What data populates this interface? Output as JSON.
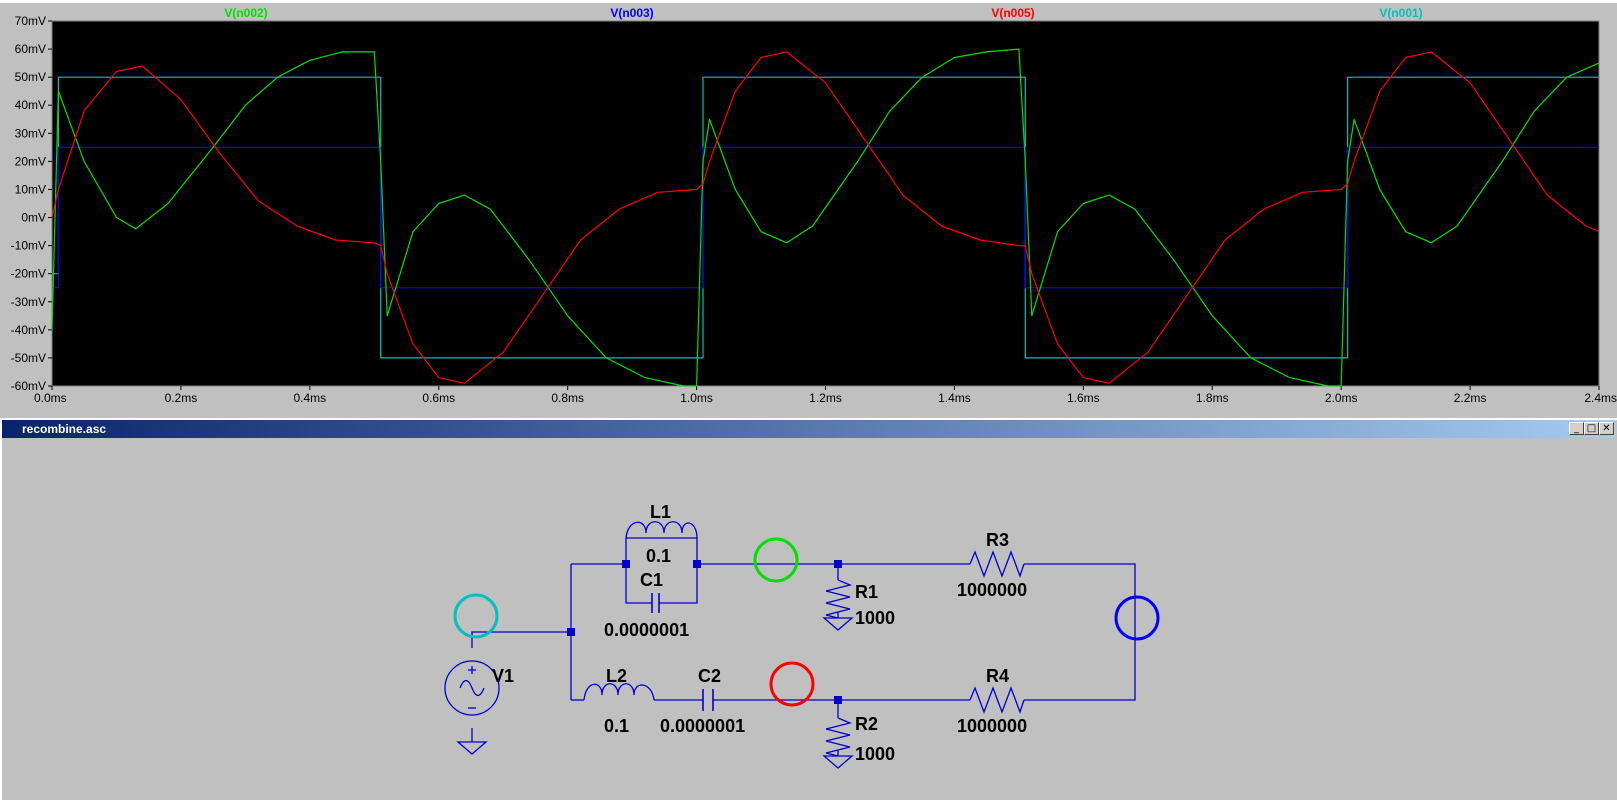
{
  "plot": {
    "traces": [
      {
        "id": "n002",
        "name": "V(n002)",
        "color": "#00e000"
      },
      {
        "id": "n003",
        "name": "V(n003)",
        "color": "#0000ff"
      },
      {
        "id": "n005",
        "name": "V(n005)",
        "color": "#ff0000"
      },
      {
        "id": "n001",
        "name": "V(n001)",
        "color": "#00c0c0"
      }
    ],
    "y_ticks": [
      "70mV",
      "60mV",
      "50mV",
      "40mV",
      "30mV",
      "20mV",
      "10mV",
      "0mV",
      "-10mV",
      "-20mV",
      "-30mV",
      "-40mV",
      "-50mV",
      "-60mV"
    ],
    "x_ticks": [
      "0.0ms",
      "0.2ms",
      "0.4ms",
      "0.6ms",
      "0.8ms",
      "1.0ms",
      "1.2ms",
      "1.4ms",
      "1.6ms",
      "1.8ms",
      "2.0ms",
      "2.2ms",
      "2.4ms"
    ],
    "background": "#000000"
  },
  "chart_data": {
    "type": "line",
    "x_unit": "ms",
    "y_unit": "mV",
    "xlim": [
      0,
      2.4
    ],
    "ylim": [
      -60,
      70
    ],
    "series": [
      {
        "name": "V(n001)",
        "x": [
          0,
          0.01,
          0.01,
          0.5,
          0.51,
          0.51,
          1.0,
          1.01,
          1.01,
          1.5,
          1.51,
          1.51,
          2.0,
          2.01,
          2.01,
          2.4
        ],
        "values": [
          -20,
          -20,
          50,
          50,
          50,
          -50,
          -50,
          -50,
          50,
          50,
          50,
          -50,
          -50,
          -50,
          50,
          50
        ]
      },
      {
        "name": "V(n003)",
        "x": [
          0,
          0.01,
          0.01,
          0.5,
          0.51,
          0.51,
          1.0,
          1.01,
          1.01,
          1.5,
          1.51,
          1.51,
          2.0,
          2.01,
          2.01,
          2.4
        ],
        "values": [
          -25,
          -25,
          25,
          25,
          25,
          -25,
          -25,
          -25,
          25,
          25,
          25,
          -25,
          -25,
          -25,
          25,
          25
        ]
      },
      {
        "name": "V(n002)",
        "x": [
          0,
          0.01,
          0.05,
          0.1,
          0.13,
          0.18,
          0.25,
          0.3,
          0.35,
          0.4,
          0.45,
          0.5,
          0.51,
          0.52,
          0.56,
          0.6,
          0.64,
          0.68,
          0.74,
          0.8,
          0.86,
          0.92,
          0.98,
          1.0,
          1.01,
          1.02,
          1.06,
          1.1,
          1.14,
          1.18,
          1.25,
          1.3,
          1.35,
          1.4,
          1.45,
          1.5,
          1.51,
          1.52,
          1.56,
          1.6,
          1.64,
          1.68,
          1.74,
          1.8,
          1.86,
          1.92,
          1.98,
          2.0,
          2.01,
          2.02,
          2.06,
          2.1,
          2.14,
          2.18,
          2.25,
          2.3,
          2.35,
          2.4
        ],
        "values": [
          -40,
          45,
          20,
          0,
          -4,
          5,
          25,
          40,
          50,
          56,
          59,
          59,
          20,
          -35,
          -5,
          5,
          8,
          3,
          -15,
          -35,
          -50,
          -57,
          -60,
          -60,
          20,
          35,
          10,
          -5,
          -9,
          -3,
          20,
          38,
          50,
          57,
          59,
          60,
          20,
          -35,
          -5,
          5,
          8,
          3,
          -15,
          -35,
          -50,
          -57,
          -60,
          -60,
          20,
          35,
          10,
          -5,
          -9,
          -3,
          20,
          38,
          50,
          55
        ]
      },
      {
        "name": "V(n005)",
        "x": [
          0,
          0.01,
          0.05,
          0.1,
          0.14,
          0.2,
          0.26,
          0.32,
          0.38,
          0.44,
          0.5,
          0.51,
          0.52,
          0.56,
          0.6,
          0.64,
          0.7,
          0.76,
          0.82,
          0.88,
          0.94,
          1.0,
          1.01,
          1.02,
          1.06,
          1.1,
          1.14,
          1.2,
          1.26,
          1.32,
          1.38,
          1.44,
          1.5,
          1.51,
          1.52,
          1.56,
          1.6,
          1.64,
          1.7,
          1.76,
          1.82,
          1.88,
          1.94,
          2.0,
          2.01,
          2.02,
          2.06,
          2.1,
          2.14,
          2.2,
          2.26,
          2.32,
          2.38,
          2.4
        ],
        "values": [
          0,
          10,
          38,
          52,
          54,
          42,
          23,
          6,
          -3,
          -8,
          -9,
          -10,
          -20,
          -45,
          -57,
          -59,
          -48,
          -28,
          -8,
          3,
          9,
          10,
          12,
          20,
          45,
          57,
          59,
          48,
          28,
          8,
          -3,
          -8,
          -10,
          -10,
          -20,
          -45,
          -57,
          -59,
          -48,
          -28,
          -8,
          3,
          9,
          10,
          12,
          20,
          45,
          57,
          59,
          48,
          28,
          8,
          -3,
          -5
        ]
      }
    ]
  },
  "window": {
    "title": "recombine.asc",
    "minimize": "_",
    "maximize": "□",
    "close": "✕"
  },
  "schematic": {
    "L1": {
      "ref": "L1",
      "value": "0.1"
    },
    "C1": {
      "ref": "C1",
      "value": "0.0000001"
    },
    "R1": {
      "ref": "R1",
      "value": "1000"
    },
    "R3": {
      "ref": "R3",
      "value": "1000000"
    },
    "V1": {
      "ref": "V1"
    },
    "L2": {
      "ref": "L2",
      "value": "0.1"
    },
    "C2": {
      "ref": "C2",
      "value": "0.0000001"
    },
    "R2": {
      "ref": "R2",
      "value": "1000"
    },
    "R4": {
      "ref": "R4",
      "value": "1000000"
    },
    "wire_color": "#0000cc",
    "probe_colors": {
      "n001": "#00c0c0",
      "n002": "#00e000",
      "n005": "#ff0000",
      "n003": "#0000ff"
    }
  }
}
